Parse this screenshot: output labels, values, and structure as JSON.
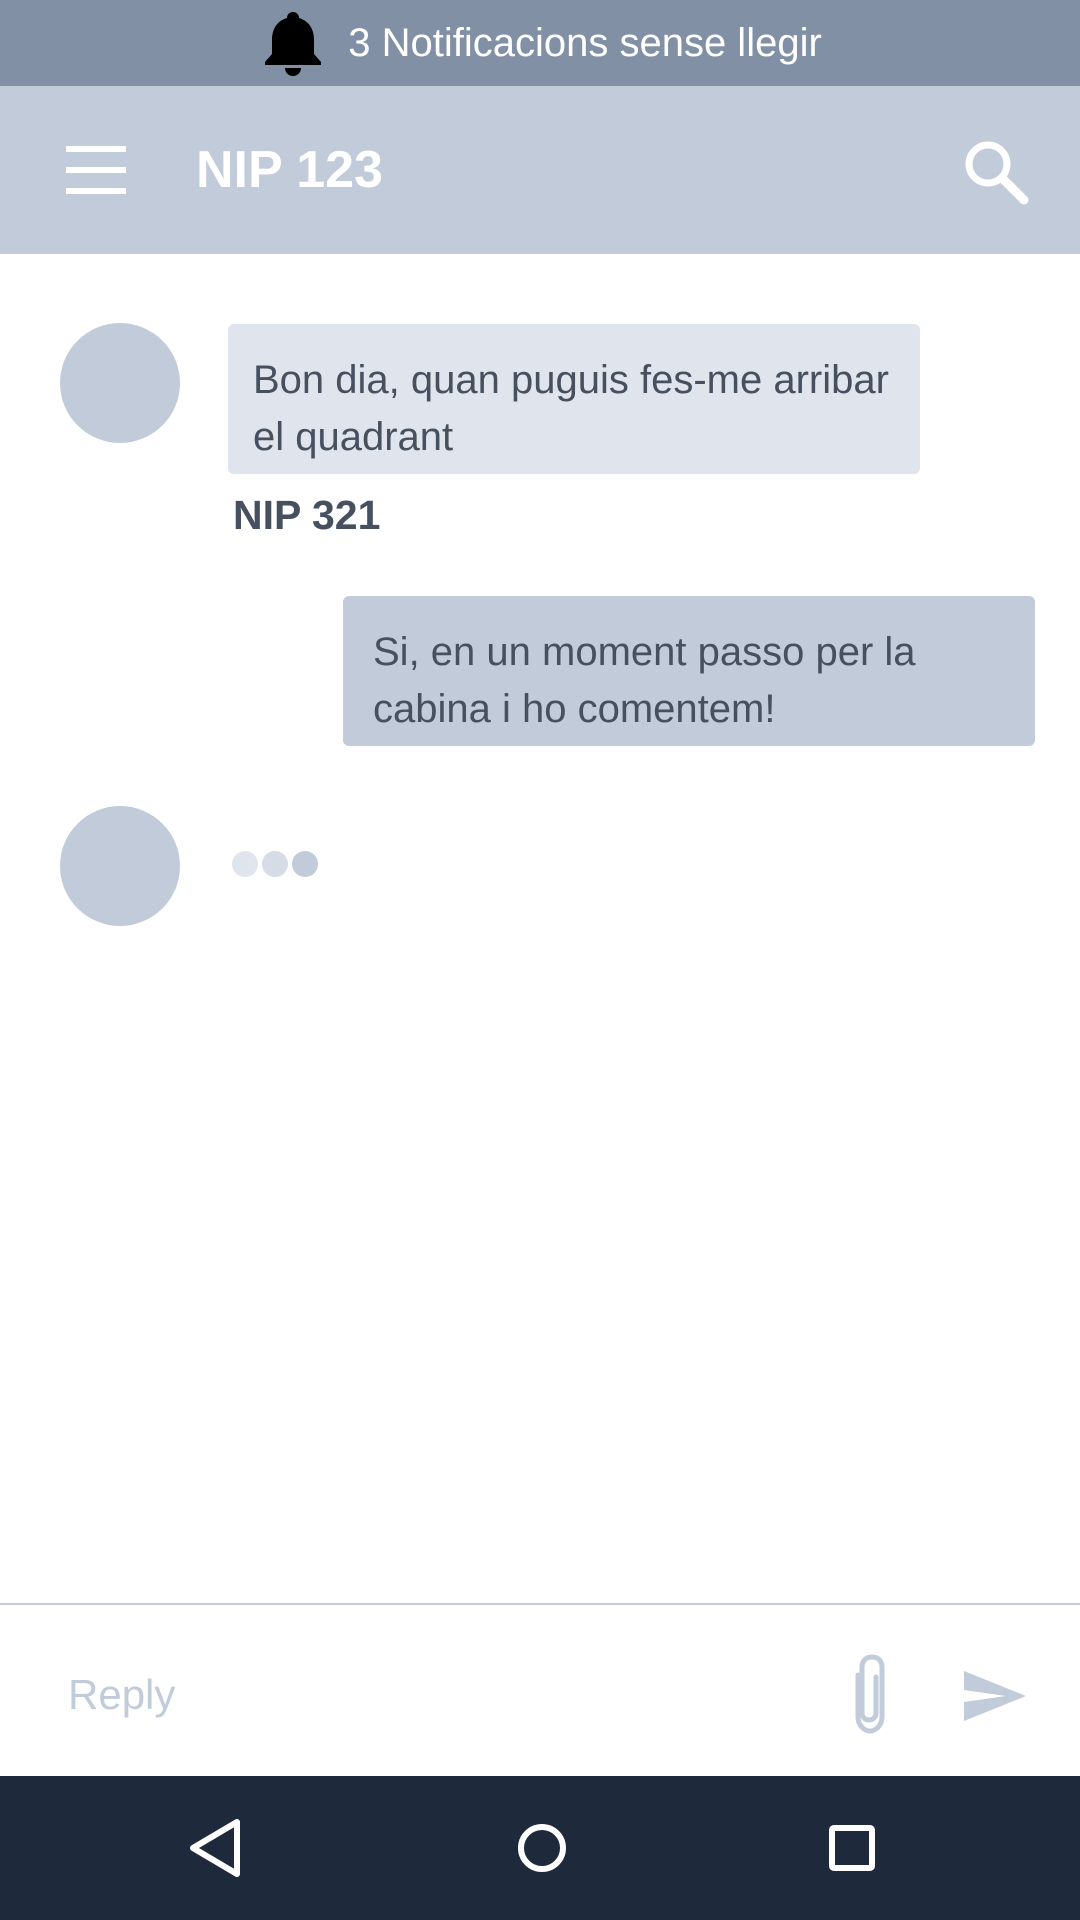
{
  "notification_bar": {
    "icon": "bell-icon",
    "text": "3 Notificacions sense llegir"
  },
  "app_bar": {
    "menu_icon": "hamburger-menu-icon",
    "title": "NIP 123",
    "search_icon": "search-icon"
  },
  "messages": [
    {
      "direction": "incoming",
      "text": "Bon dia, quan puguis fes-me arribar el quadrant",
      "sender": "NIP 321"
    },
    {
      "direction": "outgoing",
      "text": "Si, en un moment passo per la cabina i ho comentem!"
    }
  ],
  "typing_indicator": {
    "dot_colors": [
      "#e0e5ed",
      "#d5dce6",
      "#c1cbd9"
    ]
  },
  "reply_bar": {
    "placeholder": "Reply",
    "value": "",
    "attach_icon": "paperclip-icon",
    "send_icon": "send-icon"
  },
  "nav_bar": {
    "buttons": [
      "back-icon",
      "home-icon",
      "recents-icon"
    ]
  },
  "colors": {
    "notification_bg": "#8290a6",
    "app_bar_bg": "#c1cbd9",
    "incoming_bubble": "#e0e5ed",
    "outgoing_bubble": "#c1cbd9",
    "text": "#46505f",
    "nav_bar_bg": "#1e2a3b"
  }
}
